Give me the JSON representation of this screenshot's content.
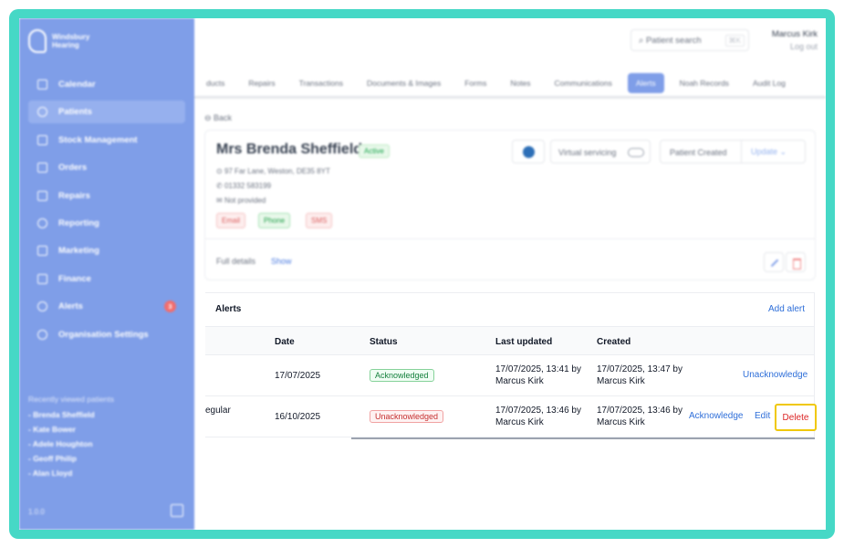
{
  "sidebar": {
    "logo_text": "Windsbury Hearing",
    "items": [
      {
        "label": "Calendar",
        "icon": "calendar-icon"
      },
      {
        "label": "Patients",
        "icon": "patients-icon"
      },
      {
        "label": "Stock Management",
        "icon": "stock-icon"
      },
      {
        "label": "Orders",
        "icon": "orders-icon"
      },
      {
        "label": "Repairs",
        "icon": "wrench-icon"
      },
      {
        "label": "Reporting",
        "icon": "chart-pie-icon"
      },
      {
        "label": "Marketing",
        "icon": "mail-icon"
      },
      {
        "label": "Finance",
        "icon": "card-icon"
      },
      {
        "label": "Alerts",
        "icon": "bell-icon",
        "badge": "3"
      },
      {
        "label": "Organisation Settings",
        "icon": "gear-icon"
      }
    ],
    "recent_title": "Recently viewed patients",
    "recent": [
      "- Brenda Sheffield",
      "- Kate Bower",
      "- Adele Houghton",
      "- Geoff Philip",
      "- Alan Lloyd"
    ],
    "version": "1.0.0"
  },
  "topbar": {
    "search_placeholder": "Patient search",
    "search_shortcut": "⌘K",
    "user_name": "Marcus Kirk",
    "logout": "Log out"
  },
  "tabs": [
    "ducts",
    "Repairs",
    "Transactions",
    "Documents & Images",
    "Forms",
    "Notes",
    "Communications",
    "Alerts",
    "Noah Records",
    "Audit Log"
  ],
  "patient": {
    "back": "Back",
    "name": "Mrs Brenda Sheffield",
    "status": "Active",
    "address": "97 Far Lane, Weston, DE35 8YT",
    "phone": "01332 583199",
    "email": "Not provided",
    "chips": {
      "email": "Email",
      "phone": "Phone",
      "sms": "SMS"
    },
    "virtual_servicing": "Virtual servicing",
    "patient_created": "Patient Created",
    "update": "Update",
    "full_details": "Full details",
    "show": "Show"
  },
  "alerts": {
    "title": "Alerts",
    "add_alert": "Add alert",
    "columns": {
      "date": "Date",
      "status": "Status",
      "last_updated": "Last updated",
      "created": "Created"
    },
    "rows": [
      {
        "type_fragment": "",
        "date": "17/07/2025",
        "status": "Acknowledged",
        "last_updated_line1": "17/07/2025, 13:41 by",
        "last_updated_line2": "Marcus Kirk",
        "created_line1": "17/07/2025, 13:47 by",
        "created_line2": "Marcus Kirk",
        "action": "Unacknowledge"
      },
      {
        "type_fragment": "egular",
        "date": "16/10/2025",
        "status": "Unacknowledged",
        "last_updated_line1": "17/07/2025, 13:46 by",
        "last_updated_line2": "Marcus Kirk",
        "created_line1": "17/07/2025, 13:46 by",
        "created_line2": "Marcus Kirk",
        "action": "Acknowledge",
        "edit": "Edit",
        "delete": "Delete"
      }
    ]
  }
}
